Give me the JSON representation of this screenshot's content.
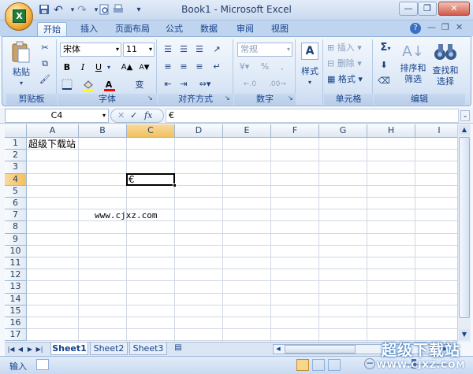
{
  "app": {
    "window_title": "Book1 - Microsoft Excel",
    "office_button_glyph": "X",
    "qat": {
      "save_icon": "save-icon",
      "undo_glyph": "↶",
      "redo_glyph": "↷",
      "customize_glyph": "▾"
    }
  },
  "window_controls": {
    "minimize": "—",
    "restore": "❐",
    "close": "✕"
  },
  "tabs": [
    {
      "label": "开始",
      "active": true
    },
    {
      "label": "插入"
    },
    {
      "label": "页面布局"
    },
    {
      "label": "公式"
    },
    {
      "label": "数据"
    },
    {
      "label": "审阅"
    },
    {
      "label": "视图"
    }
  ],
  "help_glyph": "?",
  "ribbon": {
    "clipboard": {
      "label": "剪贴板",
      "paste": "粘贴"
    },
    "font": {
      "label": "字体",
      "font_name": "宋体",
      "font_size": "11",
      "bold": "B",
      "italic": "I",
      "underline": "U",
      "grow": "A▲",
      "shrink": "A▼",
      "font_color_glyph": "A",
      "phonetic": "变"
    },
    "alignment": {
      "label": "对齐方式"
    },
    "number": {
      "label": "数字",
      "format": "常规",
      "percent": "%",
      "comma": ",",
      "increase_decimal": "←.0",
      "decrease_decimal": ".00→"
    },
    "styles": {
      "label": "样式",
      "glyph": "A"
    },
    "cells": {
      "label": "单元格",
      "insert": "插入",
      "delete": "删除",
      "format": "格式"
    },
    "editing": {
      "label": "编辑",
      "sort_filter": "排序和\n筛选",
      "find_select": "查找和\n选择",
      "sum_glyph": "Σ"
    }
  },
  "formula_bar": {
    "name_box": "C4",
    "fx": "fx",
    "content": "€"
  },
  "grid": {
    "columns": [
      "A",
      "B",
      "C",
      "D",
      "E",
      "F",
      "G",
      "H",
      "I"
    ],
    "rows": [
      "1",
      "2",
      "3",
      "4",
      "5",
      "6",
      "7",
      "8",
      "9",
      "10",
      "11",
      "12",
      "13",
      "14",
      "15",
      "16",
      "17"
    ],
    "cells": {
      "A1": "超级下载站",
      "C4": "€",
      "B7": "www.cjxz.com"
    },
    "selected_col": "C",
    "selected_row": "4"
  },
  "sheets": {
    "tabs": [
      "Sheet1",
      "Sheet2",
      "Sheet3"
    ],
    "active": "Sheet1",
    "nav": [
      "|◀",
      "◀",
      "▶",
      "▶|"
    ]
  },
  "status": {
    "mode": "输入"
  },
  "watermark": {
    "title": "超级下载站",
    "url": "WWW.CJXZ.COM"
  },
  "colors": {
    "accent": "#15428b",
    "selected_header": "#f9d99f",
    "grid_line": "#d0d7e5"
  }
}
